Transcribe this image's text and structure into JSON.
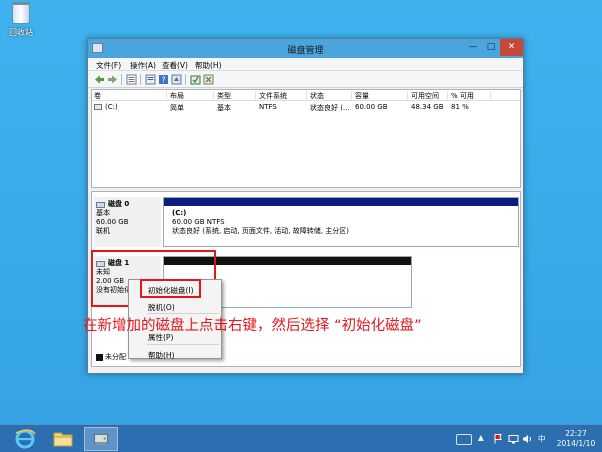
{
  "desktop": {
    "recycle_bin_label": "回收站"
  },
  "window": {
    "title": "磁盘管理",
    "minimize_glyph": "—",
    "maximize_glyph": "□",
    "close_glyph": "✕"
  },
  "menu": {
    "file": "文件(F)",
    "action": "操作(A)",
    "view": "查看(V)",
    "help": "帮助(H)"
  },
  "toolbar_icons": [
    "back-icon",
    "forward-icon",
    "list-icon",
    "properties-icon",
    "help-icon",
    "refresh-icon",
    "disk-icon",
    "settings-icon"
  ],
  "volume_table": {
    "headers": [
      "卷",
      "布局",
      "类型",
      "文件系统",
      "状态",
      "容量",
      "可用空间",
      "% 可用"
    ],
    "rows": [
      {
        "volume": "(C:)",
        "layout": "简单",
        "type": "基本",
        "file_system": "NTFS",
        "status": "状态良好 (...",
        "capacity": "60.00 GB",
        "free": "48.34 GB",
        "percent_free": "81 %"
      }
    ]
  },
  "disks": {
    "disk0": {
      "name": "磁盘 0",
      "type": "基本",
      "size": "60.00 GB",
      "state": "联机",
      "partition": {
        "drive": "(C:)",
        "size_fs": "60.00 GB NTFS",
        "status": "状态良好 (系统, 启动, 页面文件, 活动, 故障转储, 主分区)"
      }
    },
    "disk1": {
      "name": "磁盘 1",
      "type": "未知",
      "size": "2.00 GB",
      "state": "没有初始化"
    }
  },
  "legend": {
    "unallocated": "未分配"
  },
  "context_menu": {
    "initialize": "初始化磁盘(I)",
    "offline": "脱机(O)",
    "properties": "属性(P)",
    "help": "帮助(H)"
  },
  "annotation": {
    "text": "在新增加的磁盘上点击右键，然后选择 “初始化磁盘”"
  },
  "taskbar": {
    "apps": [
      "internet-explorer-icon",
      "file-explorer-icon",
      "disk-management-icon"
    ],
    "tray_lang": "中",
    "tray_up": "▲",
    "time": "22:27",
    "date": "2014/1/10"
  },
  "colors": {
    "desktop": "#3aa7e6",
    "titlebar": "#4aa5df",
    "close_button": "#c7483a",
    "primary_partition": "#0b1d82",
    "unallocated": "#111111",
    "annotation": "#e4161b",
    "taskbar": "#2b6fb0"
  }
}
